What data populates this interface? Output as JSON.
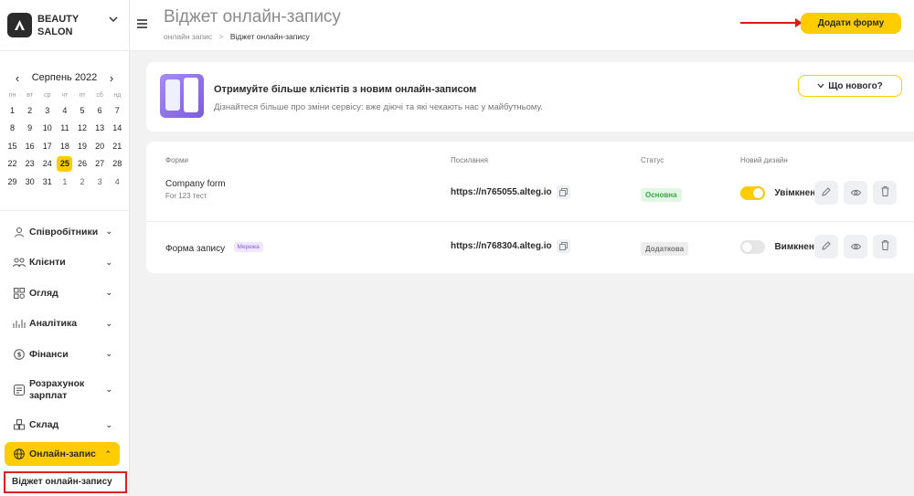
{
  "sidebar": {
    "brand": {
      "line1": "BEAUTY",
      "line2": "SALON"
    },
    "calendar": {
      "month": "Серпень 2022",
      "prev": "‹",
      "next": "›",
      "weekdays": [
        "пн",
        "вт",
        "ср",
        "чт",
        "пт",
        "сб",
        "нд"
      ],
      "days": [
        {
          "d": "1"
        },
        {
          "d": "2"
        },
        {
          "d": "3"
        },
        {
          "d": "4"
        },
        {
          "d": "5"
        },
        {
          "d": "6"
        },
        {
          "d": "7"
        },
        {
          "d": "8"
        },
        {
          "d": "9"
        },
        {
          "d": "10"
        },
        {
          "d": "11"
        },
        {
          "d": "12"
        },
        {
          "d": "13"
        },
        {
          "d": "14"
        },
        {
          "d": "15"
        },
        {
          "d": "16"
        },
        {
          "d": "17"
        },
        {
          "d": "18"
        },
        {
          "d": "19"
        },
        {
          "d": "20"
        },
        {
          "d": "21"
        },
        {
          "d": "22"
        },
        {
          "d": "23"
        },
        {
          "d": "24"
        },
        {
          "d": "25",
          "today": true
        },
        {
          "d": "26"
        },
        {
          "d": "27"
        },
        {
          "d": "28"
        },
        {
          "d": "29"
        },
        {
          "d": "30"
        },
        {
          "d": "31"
        },
        {
          "d": "1",
          "other": true
        },
        {
          "d": "2",
          "other": true
        },
        {
          "d": "3",
          "other": true
        },
        {
          "d": "4",
          "other": true
        }
      ]
    },
    "nav": [
      {
        "label": "Співробітники",
        "icon": "user-icon"
      },
      {
        "label": "Клієнти",
        "icon": "clients-icon"
      },
      {
        "label": "Огляд",
        "icon": "overview-icon"
      },
      {
        "label": "Аналітика",
        "icon": "analytics-icon"
      },
      {
        "label": "Фінанси",
        "icon": "finance-icon"
      },
      {
        "label": "Розрахунок зарплат",
        "icon": "payroll-icon"
      },
      {
        "label": "Склад",
        "icon": "warehouse-icon"
      },
      {
        "label": "Онлайн-запис",
        "icon": "globe-icon"
      }
    ],
    "sub_item": "Віджет онлайн-запису"
  },
  "header": {
    "title": "Віджет онлайн-запису",
    "breadcrumb": {
      "parent": "онлайн запис",
      "sep": ">",
      "current": "Віджет онлайн-запису"
    },
    "add_button": "Додати форму"
  },
  "promo": {
    "title": "Отримуйте більше клієнтів з новим онлайн-записом",
    "text": "Дізнайтеся більше про зміни сервісу: вже діючі та які чекають нас у майбутньому.",
    "whats_new": "Що нового?"
  },
  "table": {
    "headers": {
      "forms": "Форми",
      "link": "Посилання",
      "status": "Статус",
      "design": "Новий дизайн"
    },
    "rows": [
      {
        "name": "Company form",
        "sub": "For 123 тест",
        "tag": "",
        "link": "https://n765055.alteg.io",
        "status": "Основна",
        "status_type": "main",
        "toggle": "on",
        "toggle_label": "Увімкнено"
      },
      {
        "name": "Форма запису",
        "sub": "",
        "tag": "Мережа",
        "link": "https://n768304.alteg.io",
        "status": "Додаткова",
        "status_type": "extra",
        "toggle": "off",
        "toggle_label": "Вимкнено"
      }
    ]
  },
  "colors": {
    "accent": "#ffcc00",
    "status_main": "#3aa64a",
    "annotation": "#e01818"
  }
}
